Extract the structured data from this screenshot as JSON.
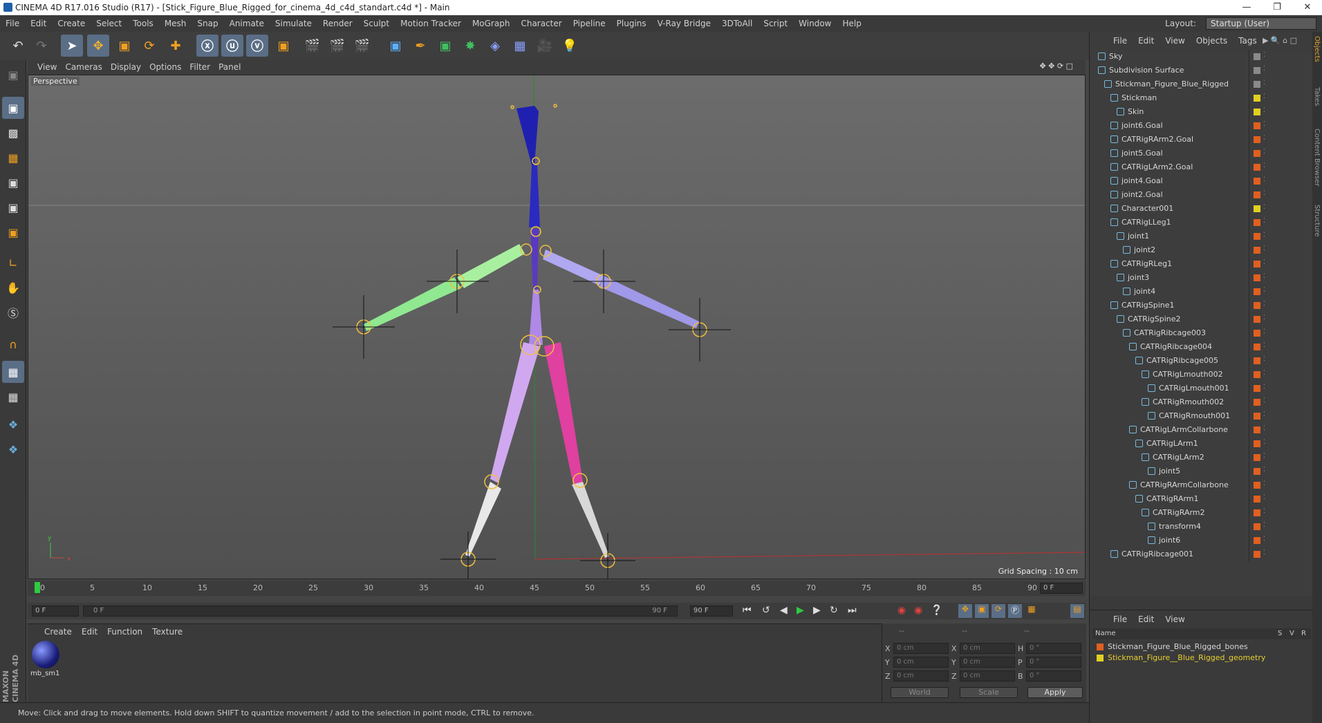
{
  "title": "CINEMA 4D R17.016 Studio (R17) - [Stick_Figure_Blue_Rigged_for_cinema_4d_c4d_standart.c4d *] - Main",
  "menu": [
    "File",
    "Edit",
    "Create",
    "Select",
    "Tools",
    "Mesh",
    "Snap",
    "Animate",
    "Simulate",
    "Render",
    "Sculpt",
    "Motion Tracker",
    "MoGraph",
    "Character",
    "Pipeline",
    "Plugins",
    "V-Ray Bridge",
    "3DToAll",
    "Script",
    "Window",
    "Help"
  ],
  "layout": {
    "label": "Layout:",
    "value": "Startup (User)"
  },
  "viewport": {
    "menu": [
      "View",
      "Cameras",
      "Display",
      "Options",
      "Filter",
      "Panel"
    ],
    "label": "Perspective",
    "grid_spacing": "Grid Spacing : 10 cm"
  },
  "timeline": {
    "ticks": [
      "0",
      "5",
      "10",
      "15",
      "20",
      "25",
      "30",
      "35",
      "40",
      "45",
      "50",
      "55",
      "60",
      "65",
      "70",
      "75",
      "80",
      "85",
      "90"
    ],
    "current_frame": "0 F",
    "start": "0 F",
    "range_start": "0 F",
    "range_end": "90 F",
    "end": "90 F"
  },
  "materials": {
    "menu": [
      "Create",
      "Edit",
      "Function",
      "Texture"
    ],
    "item": "mb_sm1"
  },
  "coords": {
    "headers": [
      "--",
      "--",
      "--"
    ],
    "rows": [
      {
        "a": "X",
        "av": "0 cm",
        "b": "X",
        "bv": "0 cm",
        "c": "H",
        "cv": "0 °"
      },
      {
        "a": "Y",
        "av": "0 cm",
        "b": "Y",
        "bv": "0 cm",
        "c": "P",
        "cv": "0 °"
      },
      {
        "a": "Z",
        "av": "0 cm",
        "b": "Z",
        "bv": "0 cm",
        "c": "B",
        "cv": "0 °"
      }
    ],
    "world": "World",
    "scale": "Scale",
    "apply": "Apply"
  },
  "status": "Move: Click and drag to move elements. Hold down SHIFT to quantize movement / add to the selection in point mode, CTRL to remove.",
  "objects": {
    "menu": [
      "File",
      "Edit",
      "View",
      "Objects",
      "Tags"
    ],
    "items": [
      {
        "name": "Sky",
        "level": 0,
        "color": "#8a8a8a"
      },
      {
        "name": "Subdivision Surface",
        "level": 0,
        "color": "#8a8a8a"
      },
      {
        "name": "Stickman_Figure_Blue_Rigged",
        "level": 1,
        "color": "#8a8a8a"
      },
      {
        "name": "Stickman",
        "level": 2,
        "color": "#e0d020"
      },
      {
        "name": "Skin",
        "level": 3,
        "color": "#e0d020"
      },
      {
        "name": "joint6.Goal",
        "level": 2,
        "color": "#e06020"
      },
      {
        "name": "CATRigRArm2.Goal",
        "level": 2,
        "color": "#e06020"
      },
      {
        "name": "joint5.Goal",
        "level": 2,
        "color": "#e06020"
      },
      {
        "name": "CATRigLArm2.Goal",
        "level": 2,
        "color": "#e06020"
      },
      {
        "name": "joint4.Goal",
        "level": 2,
        "color": "#e06020"
      },
      {
        "name": "joint2.Goal",
        "level": 2,
        "color": "#e06020"
      },
      {
        "name": "Character001",
        "level": 2,
        "color": "#e0d020"
      },
      {
        "name": "CATRigLLeg1",
        "level": 2,
        "color": "#e06020"
      },
      {
        "name": "joint1",
        "level": 3,
        "color": "#e06020"
      },
      {
        "name": "joint2",
        "level": 4,
        "color": "#e06020"
      },
      {
        "name": "CATRigRLeg1",
        "level": 2,
        "color": "#e06020"
      },
      {
        "name": "joint3",
        "level": 3,
        "color": "#e06020"
      },
      {
        "name": "joint4",
        "level": 4,
        "color": "#e06020"
      },
      {
        "name": "CATRigSpine1",
        "level": 2,
        "color": "#e06020"
      },
      {
        "name": "CATRigSpine2",
        "level": 3,
        "color": "#e06020"
      },
      {
        "name": "CATRigRibcage003",
        "level": 4,
        "color": "#e06020"
      },
      {
        "name": "CATRigRibcage004",
        "level": 5,
        "color": "#e06020"
      },
      {
        "name": "CATRigRibcage005",
        "level": 6,
        "color": "#e06020"
      },
      {
        "name": "CATRigLmouth002",
        "level": 7,
        "color": "#e06020"
      },
      {
        "name": "CATRigLmouth001",
        "level": 8,
        "color": "#e06020"
      },
      {
        "name": "CATRigRmouth002",
        "level": 7,
        "color": "#e06020"
      },
      {
        "name": "CATRigRmouth001",
        "level": 8,
        "color": "#e06020"
      },
      {
        "name": "CATRigLArmCollarbone",
        "level": 5,
        "color": "#e06020"
      },
      {
        "name": "CATRigLArm1",
        "level": 6,
        "color": "#e06020"
      },
      {
        "name": "CATRigLArm2",
        "level": 7,
        "color": "#e06020"
      },
      {
        "name": "joint5",
        "level": 8,
        "color": "#e06020"
      },
      {
        "name": "CATRigRArmCollarbone",
        "level": 5,
        "color": "#e06020"
      },
      {
        "name": "CATRigRArm1",
        "level": 6,
        "color": "#e06020"
      },
      {
        "name": "CATRigRArm2",
        "level": 7,
        "color": "#e06020"
      },
      {
        "name": "transform4",
        "level": 8,
        "color": "#e06020"
      },
      {
        "name": "joint6",
        "level": 8,
        "color": "#e06020"
      },
      {
        "name": "CATRigRibcage001",
        "level": 2,
        "color": "#e06020"
      }
    ]
  },
  "layers": {
    "menu": [
      "File",
      "Edit",
      "View"
    ],
    "header": {
      "name": "Name",
      "s": "S",
      "v": "V",
      "r": "R"
    },
    "items": [
      {
        "name": "Stickman_Figure_Blue_Rigged_bones",
        "color": "#e06020",
        "text": "#d6d6d6"
      },
      {
        "name": "Stickman_Figure__Blue_Rigged_geometry",
        "color": "#e0d020",
        "text": "#e8d030"
      }
    ]
  },
  "side_tabs": [
    "Objects",
    "Takes",
    "Content Browser",
    "Structure"
  ],
  "brand": "MAXON CINEMA 4D"
}
